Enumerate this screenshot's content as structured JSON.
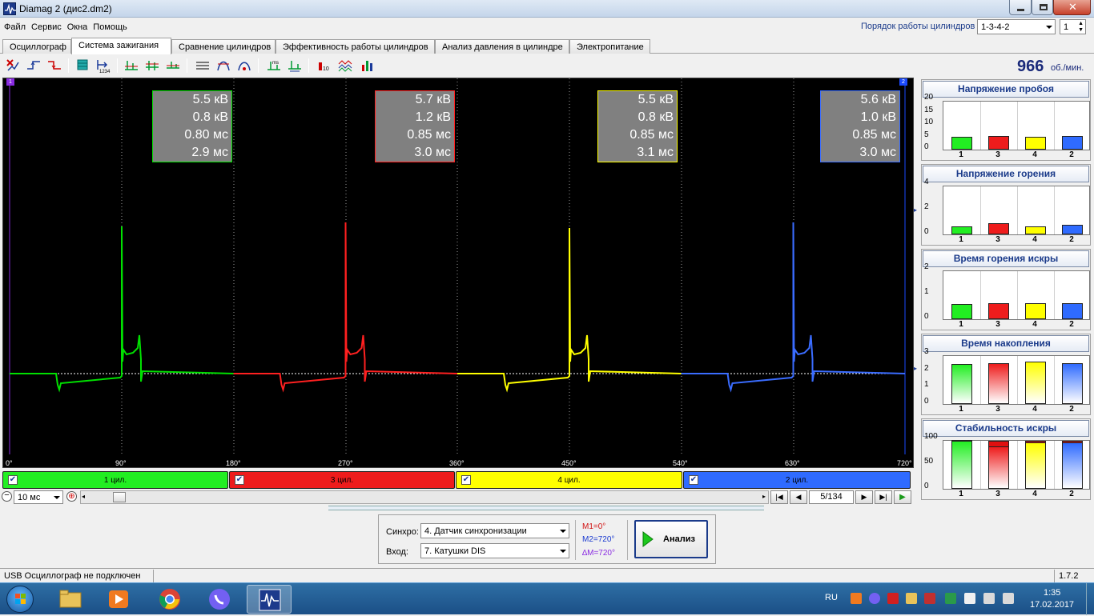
{
  "window": {
    "title": "Diamag 2 (дис2.dm2)"
  },
  "menu": [
    "Файл",
    "Сервис",
    "Окна",
    "Помощь"
  ],
  "order": {
    "label": "Порядок работы цилиндров",
    "value": "1-3-4-2",
    "spin": "1"
  },
  "tabs": [
    "Осциллограф",
    "Система зажигания",
    "Сравнение цилиндров",
    "Эффективность работы цилиндров",
    "Анализ давления в цилиндре",
    "Электропитание"
  ],
  "active_tab": 1,
  "rpm": {
    "value": "966",
    "unit": "об./мин."
  },
  "scope": {
    "markers": [
      "1",
      "2"
    ],
    "angles": [
      "0°",
      "90°",
      "180°",
      "270°",
      "360°",
      "450°",
      "540°",
      "630°",
      "720°"
    ],
    "boxes": [
      {
        "color": "#00e000",
        "lines": [
          "5.5 кВ",
          "0.8 кВ",
          "0.80 мс",
          "2.9 мс"
        ]
      },
      {
        "color": "#ff2020",
        "lines": [
          "5.7 кВ",
          "1.2 кВ",
          "0.85 мс",
          "3.0 мс"
        ]
      },
      {
        "color": "#ffff00",
        "lines": [
          "5.5 кВ",
          "0.8 кВ",
          "0.85 мс",
          "3.1 мс"
        ]
      },
      {
        "color": "#3a6cff",
        "lines": [
          "5.6 кВ",
          "1.0 кВ",
          "0.85 мс",
          "3.0 мс"
        ]
      }
    ]
  },
  "cylinders": [
    {
      "label": "1 цил.",
      "color": "#22ee22"
    },
    {
      "label": "3 цил.",
      "color": "#ee1c1c"
    },
    {
      "label": "4 цил.",
      "color": "#ffff00"
    },
    {
      "label": "2 цил.",
      "color": "#2f6bff"
    }
  ],
  "timebase": {
    "value": "10 мс"
  },
  "nav": {
    "position": "5/134"
  },
  "panels": [
    {
      "title": "Напряжение пробоя",
      "yticks": [
        "20",
        "15",
        "10",
        "5",
        "0"
      ],
      "ymax": 20,
      "values": [
        5.5,
        5.7,
        5.5,
        5.6
      ],
      "style": "flat"
    },
    {
      "title": "Напряжение горения",
      "yticks": [
        "4",
        "2",
        "0"
      ],
      "ymax": 5,
      "values": [
        0.8,
        1.2,
        0.8,
        1.0
      ],
      "style": "flat"
    },
    {
      "title": "Время горения искры",
      "yticks": [
        "2",
        "1",
        "0"
      ],
      "ymax": 2.5,
      "values": [
        0.8,
        0.85,
        0.85,
        0.85
      ],
      "style": "flat"
    },
    {
      "title": "Время накопления",
      "yticks": [
        "3",
        "2",
        "1",
        "0"
      ],
      "ymax": 3.5,
      "values": [
        2.9,
        3.0,
        3.1,
        3.0
      ],
      "style": "gradient"
    },
    {
      "title": "Стабильность искры",
      "yticks": [
        "100",
        "50",
        "0"
      ],
      "ymax": 100,
      "values": [
        100,
        88,
        97,
        97
      ],
      "style": "stability"
    }
  ],
  "panel_xlabels": [
    "1",
    "3",
    "4",
    "2"
  ],
  "bottom": {
    "sync_label": "Синхро:",
    "sync_value": "4.  Датчик синхронизации",
    "input_label": "Вход:",
    "input_value": "7.  Катушки DIS",
    "m1": "M1=0°",
    "m2": "M2=720°",
    "dm": "∆M=720°",
    "analyze": "Анализ"
  },
  "status": {
    "left": "USB Осциллограф не подключен",
    "version": "1.7.2"
  },
  "taskbar": {
    "lang": "RU",
    "time": "1:35",
    "date": "17.02.2017"
  }
}
